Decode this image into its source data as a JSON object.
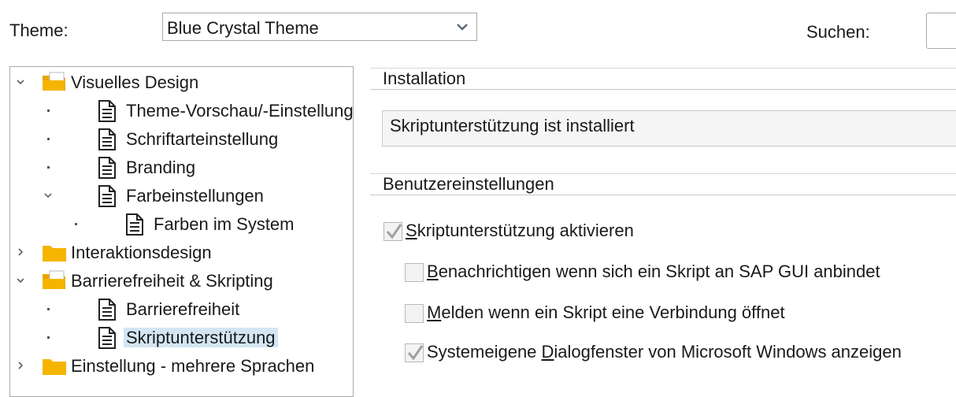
{
  "top": {
    "theme_label": "Theme:",
    "theme_value": "Blue Crystal Theme",
    "search_label": "Suchen:",
    "search_value": ""
  },
  "tree": {
    "items": [
      {
        "label": "Visuelles Design",
        "level": 0,
        "expanded": true,
        "icon": "folder-open-icon"
      },
      {
        "label": "Theme-Vorschau/-Einstellungen",
        "level": 1,
        "icon": "document-icon"
      },
      {
        "label": "Schriftarteinstellung",
        "level": 1,
        "icon": "document-icon"
      },
      {
        "label": "Branding",
        "level": 1,
        "icon": "document-icon"
      },
      {
        "label": "Farbeinstellungen",
        "level": 1,
        "expanded": true,
        "icon": "document-icon"
      },
      {
        "label": "Farben im System",
        "level": 2,
        "icon": "document-icon"
      },
      {
        "label": "Interaktionsdesign",
        "level": 0,
        "expanded": false,
        "icon": "folder-icon"
      },
      {
        "label": "Barrierefreiheit & Skripting",
        "level": 0,
        "expanded": true,
        "icon": "folder-open-icon"
      },
      {
        "label": "Barrierefreiheit",
        "level": 1,
        "icon": "document-icon"
      },
      {
        "label": "Skriptunterstützung",
        "level": 1,
        "icon": "document-icon",
        "selected": true
      },
      {
        "label": "Einstellung - mehrere Sprachen",
        "level": 0,
        "expanded": false,
        "icon": "folder-icon"
      }
    ]
  },
  "installation": {
    "header": "Installation",
    "status": "Skriptunterstützung ist installiert"
  },
  "user_settings": {
    "header": "Benutzereinstellungen",
    "enable_scripting": {
      "pre": "",
      "mnemonic": "S",
      "post": "kriptunterstützung aktivieren",
      "checked": true
    },
    "notify_attach": {
      "pre": "",
      "mnemonic": "B",
      "post": "enachrichtigen wenn sich ein Skript an SAP GUI anbindet",
      "checked": false
    },
    "notify_connection": {
      "pre": "",
      "mnemonic": "M",
      "post": "elden wenn ein Skript eine Verbindung öffnet",
      "checked": false
    },
    "native_dialogs": {
      "pre": "Systemeigene ",
      "mnemonic": "D",
      "post": "ialogfenster von Microsoft Windows anzeigen",
      "checked": true
    }
  },
  "colors": {
    "selection": "#d3e5f3",
    "folder": "#f5b400",
    "check_disabled": "#a0a0a0"
  }
}
